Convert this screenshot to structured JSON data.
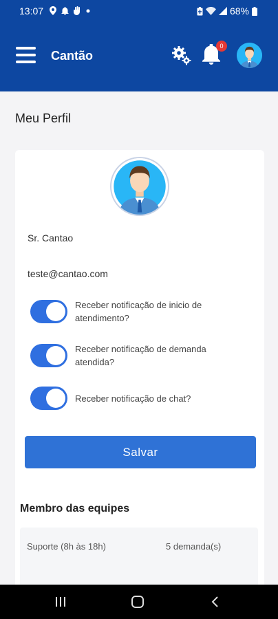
{
  "status_bar": {
    "time": "13:07",
    "battery": "68%",
    "left_icons": [
      "location-icon",
      "notification-icon",
      "hand-icon",
      "dot-icon"
    ],
    "right_icons": [
      "battery-saver-icon",
      "wifi-icon",
      "signal-icon",
      "battery-icon"
    ]
  },
  "header": {
    "title": "Cantão",
    "notification_count": "0",
    "colors": {
      "background": "#0d47a1",
      "badge": "#e53935"
    }
  },
  "page": {
    "title": "Meu Perfil"
  },
  "profile": {
    "name": "Sr. Cantao",
    "email": "teste@cantao.com",
    "preferences": [
      {
        "label": "Receber notificação de inicio de atendimento?",
        "enabled": true
      },
      {
        "label": "Receber notificação de demanda atendida?",
        "enabled": true
      },
      {
        "label": "Receber notificação de chat?",
        "enabled": true
      }
    ],
    "save_label": "Salvar",
    "colors": {
      "toggle_on": "#2f6fe0",
      "button": "#2f72d6"
    }
  },
  "teams": {
    "title": "Membro das equipes",
    "items": [
      {
        "name": "Suporte (8h às 18h)",
        "count": "5 demanda(s)"
      }
    ]
  },
  "nav_bar": {
    "buttons": [
      "recents-icon",
      "home-icon",
      "back-icon"
    ]
  }
}
